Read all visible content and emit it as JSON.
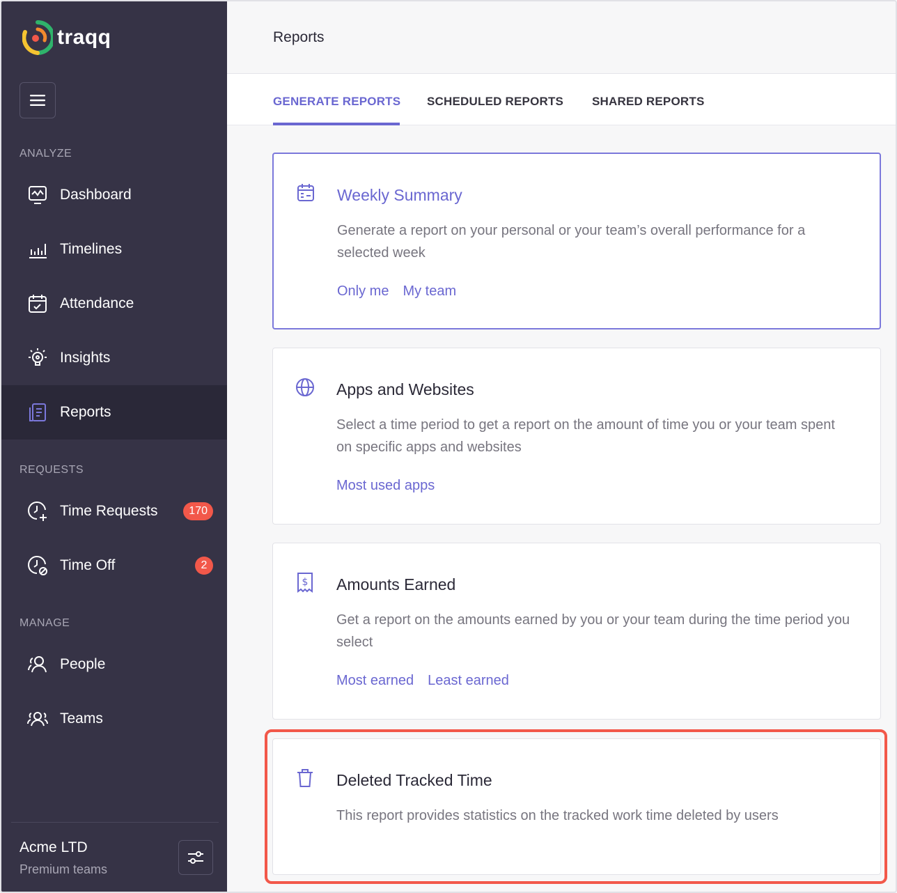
{
  "app": {
    "name": "traqq",
    "colors": {
      "sidebar": "#363346",
      "accent": "#6a67d1",
      "badge": "#f2584a",
      "highlight": "#f2584a"
    }
  },
  "sidebar": {
    "sections": {
      "analyze": "ANALYZE",
      "requests": "REQUESTS",
      "manage": "MANAGE"
    },
    "items": [
      {
        "label": "Dashboard",
        "icon": "dashboard-icon"
      },
      {
        "label": "Timelines",
        "icon": "bar-chart-icon"
      },
      {
        "label": "Attendance",
        "icon": "calendar-check-icon"
      },
      {
        "label": "Insights",
        "icon": "lightbulb-icon"
      },
      {
        "label": "Reports",
        "icon": "reports-icon",
        "active": true
      },
      {
        "label": "Time Requests",
        "icon": "clock-plus-icon",
        "badge": "170"
      },
      {
        "label": "Time Off",
        "icon": "clock-off-icon",
        "badge": "2"
      },
      {
        "label": "People",
        "icon": "people-icon"
      },
      {
        "label": "Teams",
        "icon": "teams-icon"
      }
    ],
    "org": {
      "name": "Acme LTD",
      "plan": "Premium teams"
    }
  },
  "header": {
    "title": "Reports"
  },
  "tabs": [
    {
      "label": "GENERATE REPORTS",
      "active": true
    },
    {
      "label": "SCHEDULED REPORTS"
    },
    {
      "label": "SHARED REPORTS"
    }
  ],
  "cards": [
    {
      "title": "Weekly Summary",
      "icon": "calendar-icon",
      "description": "Generate a report on your personal or your team’s overall performance for a selected week",
      "links": [
        "Only me",
        "My team"
      ]
    },
    {
      "title": "Apps and Websites",
      "icon": "globe-icon",
      "description": "Select a time period to get a report on the amount of time you or your team spent on specific apps and websites",
      "links": [
        "Most used apps"
      ]
    },
    {
      "title": "Amounts Earned",
      "icon": "receipt-dollar-icon",
      "description": "Get a report on the amounts earned by you or your team during the time period you select",
      "links": [
        "Most earned",
        "Least earned"
      ]
    },
    {
      "title": "Deleted Tracked Time",
      "icon": "trash-icon",
      "description": "This report provides statistics on the tracked work time deleted by users",
      "links": []
    }
  ]
}
